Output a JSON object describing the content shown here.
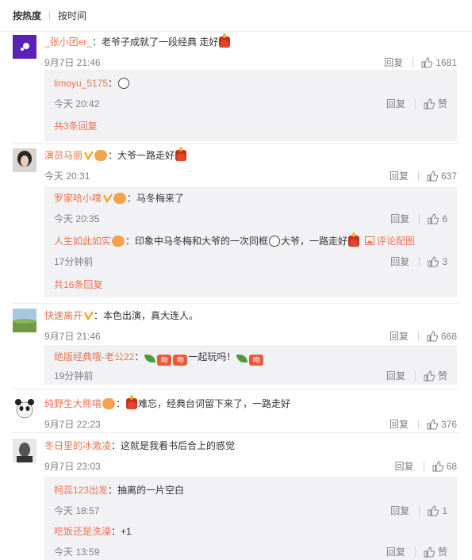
{
  "sort": {
    "hot": "按热度",
    "time": "按时间"
  },
  "actions": {
    "reply": "回复",
    "like_default": "赞"
  },
  "colors": {
    "username": "#eb7350",
    "meta": "#808080",
    "reply_bg": "#f2f2f5"
  },
  "comments": [
    {
      "user": "_张小团er_",
      "text": "：老爷子成就了一段经典 走好",
      "time": "9月7日 21:46",
      "likes": "1681",
      "replies": [
        {
          "user": "limoyu_5175",
          "text": "：",
          "time": "今天 20:42",
          "likes": "赞"
        }
      ],
      "more": "共3条回复"
    },
    {
      "user": "演员马丽",
      "text": "：大爷一路走好",
      "time": "今天 20:31",
      "likes": "637",
      "replies": [
        {
          "user": "罗家哈小噗",
          "text": "：马冬梅来了",
          "time": "今天 20:35",
          "likes": "6"
        },
        {
          "user": "人生如此如实",
          "text": "：印象中马冬梅和大爷的一次同框",
          "text2": "大爷，一路走好",
          "pic": "评论配图",
          "time": "17分钟前",
          "likes": "3"
        }
      ],
      "more": "共16条回复"
    },
    {
      "user": "快速离开",
      "text": "：本色出演，真大连人。",
      "time": "9月7日 21:46",
      "likes": "668",
      "replies": [
        {
          "user": "绝版经典哦-老公22",
          "text": "：",
          "text2": "一起玩吗！",
          "time": "19分钟前",
          "likes": "赞"
        }
      ]
    },
    {
      "user": "纯野生大熊嘻",
      "text": "：",
      "text2": "难忘，经典台词留下来了，一路走好",
      "time": "9月7日 22:23",
      "likes": "376"
    },
    {
      "user": "冬日里的冰激凌",
      "text": "：这就是我看书后合上的感觉",
      "time": "9月7日 23:03",
      "likes": "68",
      "replies": [
        {
          "user": "柯蕊123出发",
          "text": "：抽离的一片空白",
          "time": "今天 18:57",
          "likes": "1"
        },
        {
          "user": "吃饭还是洗澡",
          "text": "：+1",
          "time": "今天 13:59",
          "likes": "赞"
        }
      ]
    }
  ]
}
